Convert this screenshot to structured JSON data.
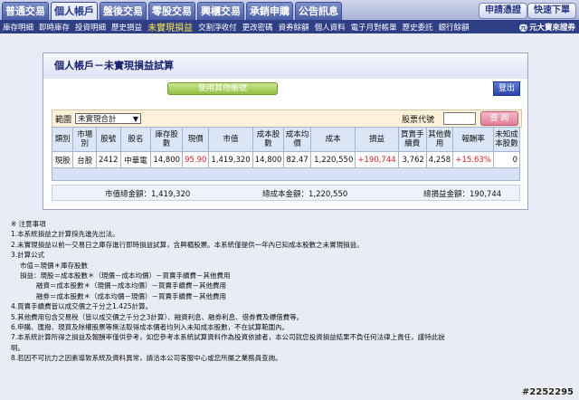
{
  "top_tabs": [
    "普通交易",
    "個人帳戶",
    "盤後交易",
    "零股交易",
    "興櫃交易",
    "承銷申購",
    "公告訊息"
  ],
  "top_active": 1,
  "top_right": {
    "apply": "申請憑證",
    "quick": "快速下單"
  },
  "sub_nav": [
    "庫存明細",
    "即時庫存",
    "投資明細",
    "歷史損益",
    "未實現損益",
    "交割淨收付",
    "更改密碼",
    "資券餘額",
    "個人資料",
    "電子月對帳單",
    "歷史委託",
    "銀行餘額"
  ],
  "sub_active": 4,
  "logo": {
    "mark": "元",
    "text": "元大寶來證券"
  },
  "panel": {
    "title": "個人帳戶－未實現損益試算",
    "history_button": "使用其他帳號",
    "exit_button": "登出"
  },
  "filter": {
    "range_label": "範圍",
    "range_value": "未實現合計",
    "code_label": "股票代號",
    "code_value": "",
    "query_button": "查 詢"
  },
  "table": {
    "headers": [
      "類別",
      "市場別",
      "股號",
      "股名",
      "庫存股數",
      "現價",
      "市值",
      "成本股數",
      "成本均價",
      "成本",
      "損益",
      "買賣手續費",
      "其他費用",
      "報酬率",
      "未知成本股數"
    ],
    "rows": [
      [
        "現股",
        "台股",
        "2412",
        "中華電",
        "14,800",
        "95.90",
        "1,419,320",
        "14,800",
        "82.47",
        "1,220,550",
        "+190,744",
        "3,762",
        "4,258",
        "+15.63%",
        "0"
      ]
    ]
  },
  "totals": {
    "market_value": "市值總金額：1,419,320",
    "cost": "總成本金額：1,220,550",
    "profit": "總損益金額：190,744"
  },
  "notes": [
    "※ 注意事項",
    "1.本系統損益之計算採先進先出法。",
    "2.未實現損益以前一交易日之庫存進行即時損益試算，含興櫃股票。本系統僅提供一年內已知成本股數之未實現損益。",
    "3.計算公式",
    "市值＝現價＊庫存股數",
    "損益：現股＝成本股數＊（現價－成本均價）－買賣手續費－其他費用",
    "融資＝成本股數＊（現價－成本均價）－買賣手續費－其他費用",
    "融券＝成本股數＊（成本均價－現價）－買賣手續費－其他費用",
    "4.買賣手續費皆以成交價之千分之1.425計算。",
    "5.其他費用包含交易稅（皆以成交價之千分之3計算）、融資利息、融券利息、借券費及標借費等。",
    "6.申購、匯撥、現買及除權股票等無法取得成本價者均列入未知成本股數，不在試算範圍內。",
    "7.本系統計算所得之損益及報酬率僅供參考，如您參考本系統試算資料作為投資依據者，本公司就您投資損益結果不負任何法律上責任，謹特此說",
    "明。",
    "8.若因不可抗力之因素導致系統及資料異常，請洽本公司客服中心或您所屬之業務員查詢。"
  ],
  "watermark": "#2252295"
}
